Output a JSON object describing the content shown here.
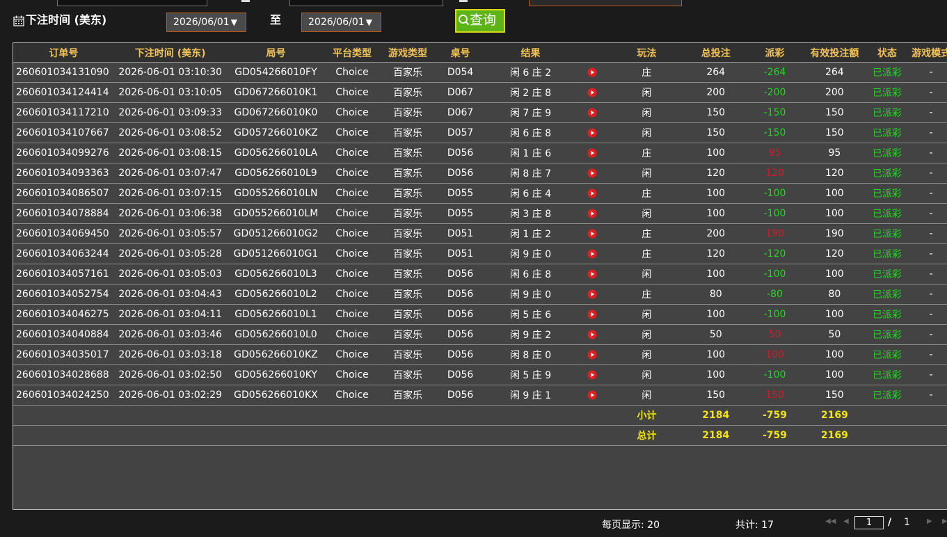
{
  "filter": {
    "label": "下注时间 (美东)",
    "start_date": "2026/06/01",
    "end_date": "2026/06/01",
    "to_label": "至",
    "query_label": "查询"
  },
  "table": {
    "headers": [
      "订单号",
      "下注时间 (美东)",
      "局号",
      "平台类型",
      "游戏类型",
      "桌号",
      "结果",
      "",
      "玩法",
      "总投注",
      "派彩",
      "有效投注额",
      "状态",
      "游戏模式"
    ],
    "rows": [
      {
        "order": "260601034131090",
        "time": "2026-06-01 03:10:30",
        "round": "GD054266010FY",
        "platform": "Choice",
        "game": "百家乐",
        "table": "D054",
        "result": "闲 6 庄 2",
        "play": "庄",
        "bet": "264",
        "payout": "-264",
        "payout_color": "green",
        "valid": "264",
        "status": "已派彩",
        "mode": "-"
      },
      {
        "order": "260601034124414",
        "time": "2026-06-01 03:10:05",
        "round": "GD067266010K1",
        "platform": "Choice",
        "game": "百家乐",
        "table": "D067",
        "result": "闲 2 庄 8",
        "play": "闲",
        "bet": "200",
        "payout": "-200",
        "payout_color": "green",
        "valid": "200",
        "status": "已派彩",
        "mode": "-"
      },
      {
        "order": "260601034117210",
        "time": "2026-06-01 03:09:33",
        "round": "GD067266010K0",
        "platform": "Choice",
        "game": "百家乐",
        "table": "D067",
        "result": "闲 7 庄 9",
        "play": "闲",
        "bet": "150",
        "payout": "-150",
        "payout_color": "green",
        "valid": "150",
        "status": "已派彩",
        "mode": "-"
      },
      {
        "order": "260601034107667",
        "time": "2026-06-01 03:08:52",
        "round": "GD057266010KZ",
        "platform": "Choice",
        "game": "百家乐",
        "table": "D057",
        "result": "闲 6 庄 8",
        "play": "闲",
        "bet": "150",
        "payout": "-150",
        "payout_color": "green",
        "valid": "150",
        "status": "已派彩",
        "mode": "-"
      },
      {
        "order": "260601034099276",
        "time": "2026-06-01 03:08:15",
        "round": "GD056266010LA",
        "platform": "Choice",
        "game": "百家乐",
        "table": "D056",
        "result": "闲 1 庄 6",
        "play": "庄",
        "bet": "100",
        "payout": "95",
        "payout_color": "red",
        "valid": "95",
        "status": "已派彩",
        "mode": "-"
      },
      {
        "order": "260601034093363",
        "time": "2026-06-01 03:07:47",
        "round": "GD056266010L9",
        "platform": "Choice",
        "game": "百家乐",
        "table": "D056",
        "result": "闲 8 庄 7",
        "play": "闲",
        "bet": "120",
        "payout": "120",
        "payout_color": "red",
        "valid": "120",
        "status": "已派彩",
        "mode": "-"
      },
      {
        "order": "260601034086507",
        "time": "2026-06-01 03:07:15",
        "round": "GD055266010LN",
        "platform": "Choice",
        "game": "百家乐",
        "table": "D055",
        "result": "闲 6 庄 4",
        "play": "庄",
        "bet": "100",
        "payout": "-100",
        "payout_color": "green",
        "valid": "100",
        "status": "已派彩",
        "mode": "-"
      },
      {
        "order": "260601034078884",
        "time": "2026-06-01 03:06:38",
        "round": "GD055266010LM",
        "platform": "Choice",
        "game": "百家乐",
        "table": "D055",
        "result": "闲 3 庄 8",
        "play": "闲",
        "bet": "100",
        "payout": "-100",
        "payout_color": "green",
        "valid": "100",
        "status": "已派彩",
        "mode": "-"
      },
      {
        "order": "260601034069450",
        "time": "2026-06-01 03:05:57",
        "round": "GD051266010G2",
        "platform": "Choice",
        "game": "百家乐",
        "table": "D051",
        "result": "闲 1 庄 2",
        "play": "庄",
        "bet": "200",
        "payout": "190",
        "payout_color": "red",
        "valid": "190",
        "status": "已派彩",
        "mode": "-"
      },
      {
        "order": "260601034063244",
        "time": "2026-06-01 03:05:28",
        "round": "GD051266010G1",
        "platform": "Choice",
        "game": "百家乐",
        "table": "D051",
        "result": "闲 9 庄 0",
        "play": "庄",
        "bet": "120",
        "payout": "-120",
        "payout_color": "green",
        "valid": "120",
        "status": "已派彩",
        "mode": "-"
      },
      {
        "order": "260601034057161",
        "time": "2026-06-01 03:05:03",
        "round": "GD056266010L3",
        "platform": "Choice",
        "game": "百家乐",
        "table": "D056",
        "result": "闲 6 庄 8",
        "play": "闲",
        "bet": "100",
        "payout": "-100",
        "payout_color": "green",
        "valid": "100",
        "status": "已派彩",
        "mode": "-"
      },
      {
        "order": "260601034052754",
        "time": "2026-06-01 03:04:43",
        "round": "GD056266010L2",
        "platform": "Choice",
        "game": "百家乐",
        "table": "D056",
        "result": "闲 9 庄 0",
        "play": "庄",
        "bet": "80",
        "payout": "-80",
        "payout_color": "green",
        "valid": "80",
        "status": "已派彩",
        "mode": "-"
      },
      {
        "order": "260601034046275",
        "time": "2026-06-01 03:04:11",
        "round": "GD056266010L1",
        "platform": "Choice",
        "game": "百家乐",
        "table": "D056",
        "result": "闲 5 庄 6",
        "play": "闲",
        "bet": "100",
        "payout": "-100",
        "payout_color": "green",
        "valid": "100",
        "status": "已派彩",
        "mode": "-"
      },
      {
        "order": "260601034040884",
        "time": "2026-06-01 03:03:46",
        "round": "GD056266010L0",
        "platform": "Choice",
        "game": "百家乐",
        "table": "D056",
        "result": "闲 9 庄 2",
        "play": "闲",
        "bet": "50",
        "payout": "50",
        "payout_color": "red",
        "valid": "50",
        "status": "已派彩",
        "mode": "-"
      },
      {
        "order": "260601034035017",
        "time": "2026-06-01 03:03:18",
        "round": "GD056266010KZ",
        "platform": "Choice",
        "game": "百家乐",
        "table": "D056",
        "result": "闲 8 庄 0",
        "play": "闲",
        "bet": "100",
        "payout": "100",
        "payout_color": "red",
        "valid": "100",
        "status": "已派彩",
        "mode": "-"
      },
      {
        "order": "260601034028688",
        "time": "2026-06-01 03:02:50",
        "round": "GD056266010KY",
        "platform": "Choice",
        "game": "百家乐",
        "table": "D056",
        "result": "闲 5 庄 9",
        "play": "闲",
        "bet": "100",
        "payout": "-100",
        "payout_color": "green",
        "valid": "100",
        "status": "已派彩",
        "mode": "-"
      },
      {
        "order": "260601034024250",
        "time": "2026-06-01 03:02:29",
        "round": "GD056266010KX",
        "platform": "Choice",
        "game": "百家乐",
        "table": "D056",
        "result": "闲 9 庄 1",
        "play": "闲",
        "bet": "150",
        "payout": "150",
        "payout_color": "red",
        "valid": "150",
        "status": "已派彩",
        "mode": "-"
      }
    ],
    "subtotal": {
      "label": "小计",
      "bet": "2184",
      "payout": "-759",
      "valid": "2169"
    },
    "total": {
      "label": "总计",
      "bet": "2184",
      "payout": "-759",
      "valid": "2169"
    }
  },
  "footer": {
    "page_size_text": "每页显示: 20",
    "total_text": "共计: 17",
    "current_page": "1",
    "separator": "/",
    "total_pages": "1"
  },
  "icons": {
    "calendar": "calendar-icon",
    "search": "search-icon",
    "play": "play-video-icon",
    "pager": [
      "first-page-icon",
      "prev-page-icon",
      "next-page-icon",
      "last-page-icon"
    ]
  },
  "colors": {
    "header_text": "#f0c257",
    "payout_negative": "#24d624",
    "payout_positive": "#d01c2a",
    "status": "#24d624",
    "summary": "#f2e40c",
    "query_button": "#5cb416",
    "date_border": "#c2571a"
  }
}
